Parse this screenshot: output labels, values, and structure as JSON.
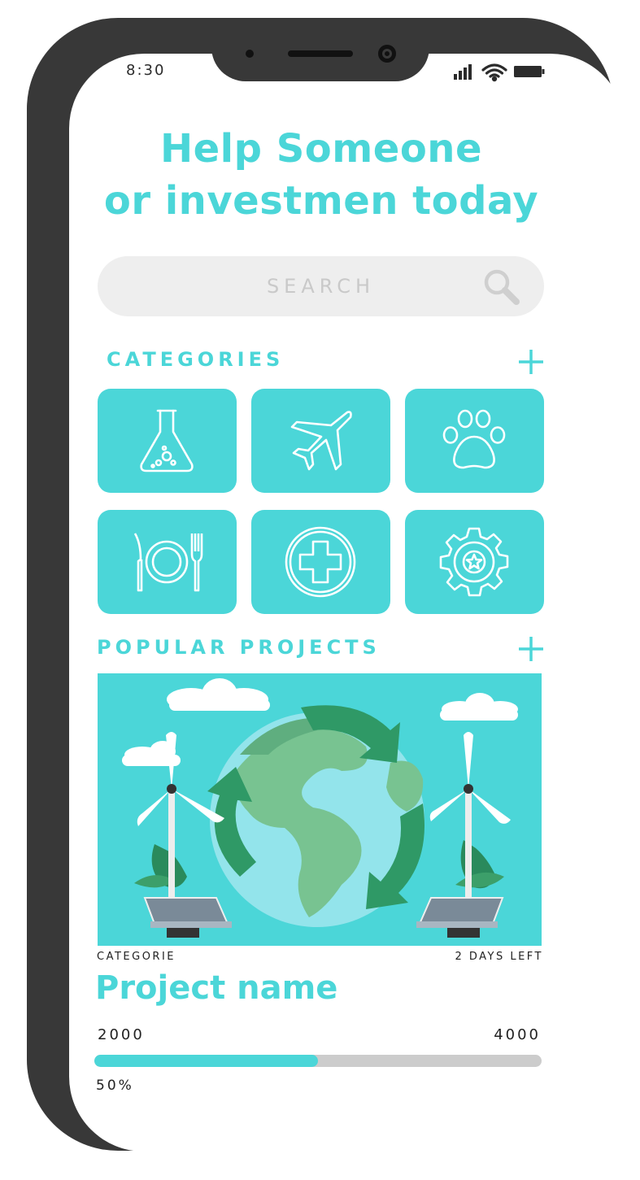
{
  "status_bar": {
    "time": "8:30",
    "icons": [
      "signal-icon",
      "wifi-icon",
      "battery-icon"
    ]
  },
  "headline": {
    "line1": "Help Someone",
    "line2": "or investmen today"
  },
  "search": {
    "placeholder": "SEARCH",
    "icon": "search-icon"
  },
  "categories": {
    "title": "CATEGORIES",
    "add_icon": "plus-icon",
    "items": [
      {
        "icon": "flask-icon"
      },
      {
        "icon": "airplane-icon"
      },
      {
        "icon": "paw-icon"
      },
      {
        "icon": "plate-cutlery-icon"
      },
      {
        "icon": "medical-cross-icon"
      },
      {
        "icon": "gear-star-icon"
      }
    ]
  },
  "popular": {
    "title": "POPULAR PROJECTS",
    "add_icon": "plus-icon",
    "project": {
      "image": "earth-recycle-wind-turbines-illustration",
      "category": "CATEGORIE",
      "time_left": "2 DAYS LEFT",
      "name": "Project name",
      "raised": "2000",
      "goal": "4000",
      "progress": 0.5,
      "progress_label": "50%"
    }
  },
  "colors": {
    "accent": "#4bd6d8",
    "frame": "#383838",
    "search_bg": "#eeeeee",
    "track": "#cccccc"
  }
}
